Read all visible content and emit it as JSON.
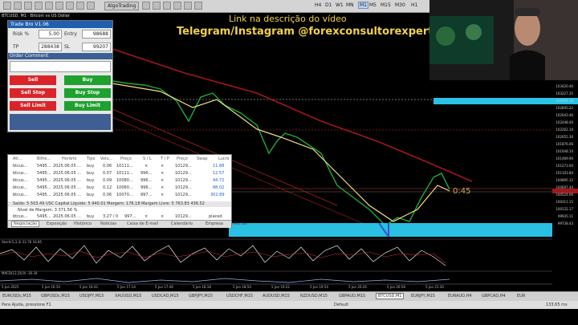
{
  "toolbar": {
    "algo_label": "AlgoTrading",
    "timeframes": [
      "H4",
      "D1",
      "W1",
      "MN",
      "M1",
      "M5",
      "M15",
      "M30",
      "H1"
    ],
    "active_tf": "M1"
  },
  "chart": {
    "title": "BTCUSD, M1 · Bitcoin vs US Dollar",
    "overlay_line1": "Link na descrição do vídeo",
    "overlay_line2": "Telegram/Instagram @forexconsultorexpertbr",
    "countdown": "0:45",
    "price_labels": [
      "103420.40",
      "103227.35",
      "103041.19",
      "102845.22",
      "102643.46",
      "102448.40",
      "102262.10",
      "102055.36",
      "101876.06",
      "101648.10",
      "101469.90",
      "101273.00",
      "101103.80",
      "100895.12",
      "100697.44",
      "100524.06",
      "100311.15",
      "100132.17",
      "99935.11",
      "99738.43"
    ],
    "time_labels": [
      "5 Jun 2025",
      "5 Jun 16:10",
      "5 Jun 16:42",
      "5 Jun 17:14",
      "5 Jun 17:46",
      "5 Jun 18:18",
      "5 Jun 18:50",
      "5 Jun 19:22",
      "5 Jun 19:54",
      "5 Jun 20:26",
      "5 Jun 20:58",
      "5 Jun 21:30"
    ],
    "indicator1": "Stoch(5,3,3) 22.76 16.85",
    "indicator2": "MACD(12,26,9) -16.34"
  },
  "trade_panel": {
    "title": "Trade Bro V1.06",
    "risk_label": "Risk %",
    "risk_value": "5.00",
    "entry_label": "Entry",
    "entry_value": "98688",
    "tp_label": "TP",
    "tp_value": "288438",
    "sl_label": "SL",
    "sl_value": "99207",
    "order_comment": "Order Comment",
    "buttons": {
      "sell": "Sell",
      "buy": "Buy",
      "sell_stop": "Sell Stop",
      "buy_stop": "Buy Stop",
      "sell_limit": "Sell Limit",
      "buy_limit": "Buy Limit"
    }
  },
  "positions": {
    "headers": [
      "Ati...",
      "Bilhe...",
      "Horário",
      "Tipo",
      "Volu...",
      "Preço",
      "S / L",
      "T / P",
      "Preço",
      "Swap",
      "Lucro"
    ],
    "rows": [
      {
        "symbol": "btcus...",
        "ticket": "5495...",
        "time": "2025.06.05 ...",
        "type": "buy",
        "volume": "0.06",
        "price": "10111...",
        "sl": "×",
        "tp": "×",
        "cur": "10129...",
        "profit": "11.68"
      },
      {
        "symbol": "btcus...",
        "ticket": "5495...",
        "time": "2025.06.05 ...",
        "type": "buy",
        "volume": "0.07",
        "price": "10111...",
        "sl": "996...",
        "tp": "×",
        "cur": "10129...",
        "profit": "12.57"
      },
      {
        "symbol": "btcus...",
        "ticket": "5495...",
        "time": "2025.06.05 ...",
        "type": "buy",
        "volume": "0.09",
        "price": "10080...",
        "sl": "996...",
        "tp": "×",
        "cur": "10129...",
        "profit": "44.72"
      },
      {
        "symbol": "btcus...",
        "ticket": "5495...",
        "time": "2025.06.05 ...",
        "type": "buy",
        "volume": "0.12",
        "price": "10060...",
        "sl": "996...",
        "tp": "×",
        "cur": "10129...",
        "profit": "88.02"
      },
      {
        "symbol": "btcus...",
        "ticket": "5495...",
        "time": "2025.06.05 ...",
        "type": "buy",
        "volume": "0.06",
        "price": "10070...",
        "sl": "997...",
        "tp": "×",
        "cur": "10129...",
        "profit": "302.89"
      }
    ],
    "balance_line": "Saldo: 5 503.49 USC  Capital Líquido: 5 940.01  Margem: 176.18  Margem Livre: 5 763.83  436.52",
    "margin_line": "Nível de Margem: 3 371.56 %",
    "pending_row": {
      "symbol": "btcus...",
      "ticket": "5495...",
      "time": "2025.06.05 ...",
      "type": "buy",
      "volume": "3.27 / 0",
      "price": "997...",
      "sl": "×",
      "tp": "×",
      "cur": "10129...",
      "status": "placed"
    },
    "tabs": [
      "Negociação",
      "Exposição",
      "Histórico",
      "Notícias",
      "Caixa de E-mail",
      "Calendário",
      "Empresa",
      "Alertas"
    ],
    "active_tab": "Negociação"
  },
  "symbol_tabs": [
    "EURUSDc,M15",
    "GBPUSDc,M15",
    "USDJPY,M15",
    "XAUUSD,M15",
    "USDCAD,M15",
    "GBPJPY,M15",
    "USDCHF,M15",
    "AUDUSD,M15",
    "NZDUSD,M15",
    "GBPAUD,M15",
    "BTCUSD,M1",
    "EURJPY,M15",
    "EURAUD,H4",
    "GBPCAD,H4",
    "EUR"
  ],
  "active_symbol": "BTCUSD,M1",
  "status": {
    "left": "Para Ajuda, pressione F1",
    "mid": "Default",
    "right": "133.65 ms"
  }
}
